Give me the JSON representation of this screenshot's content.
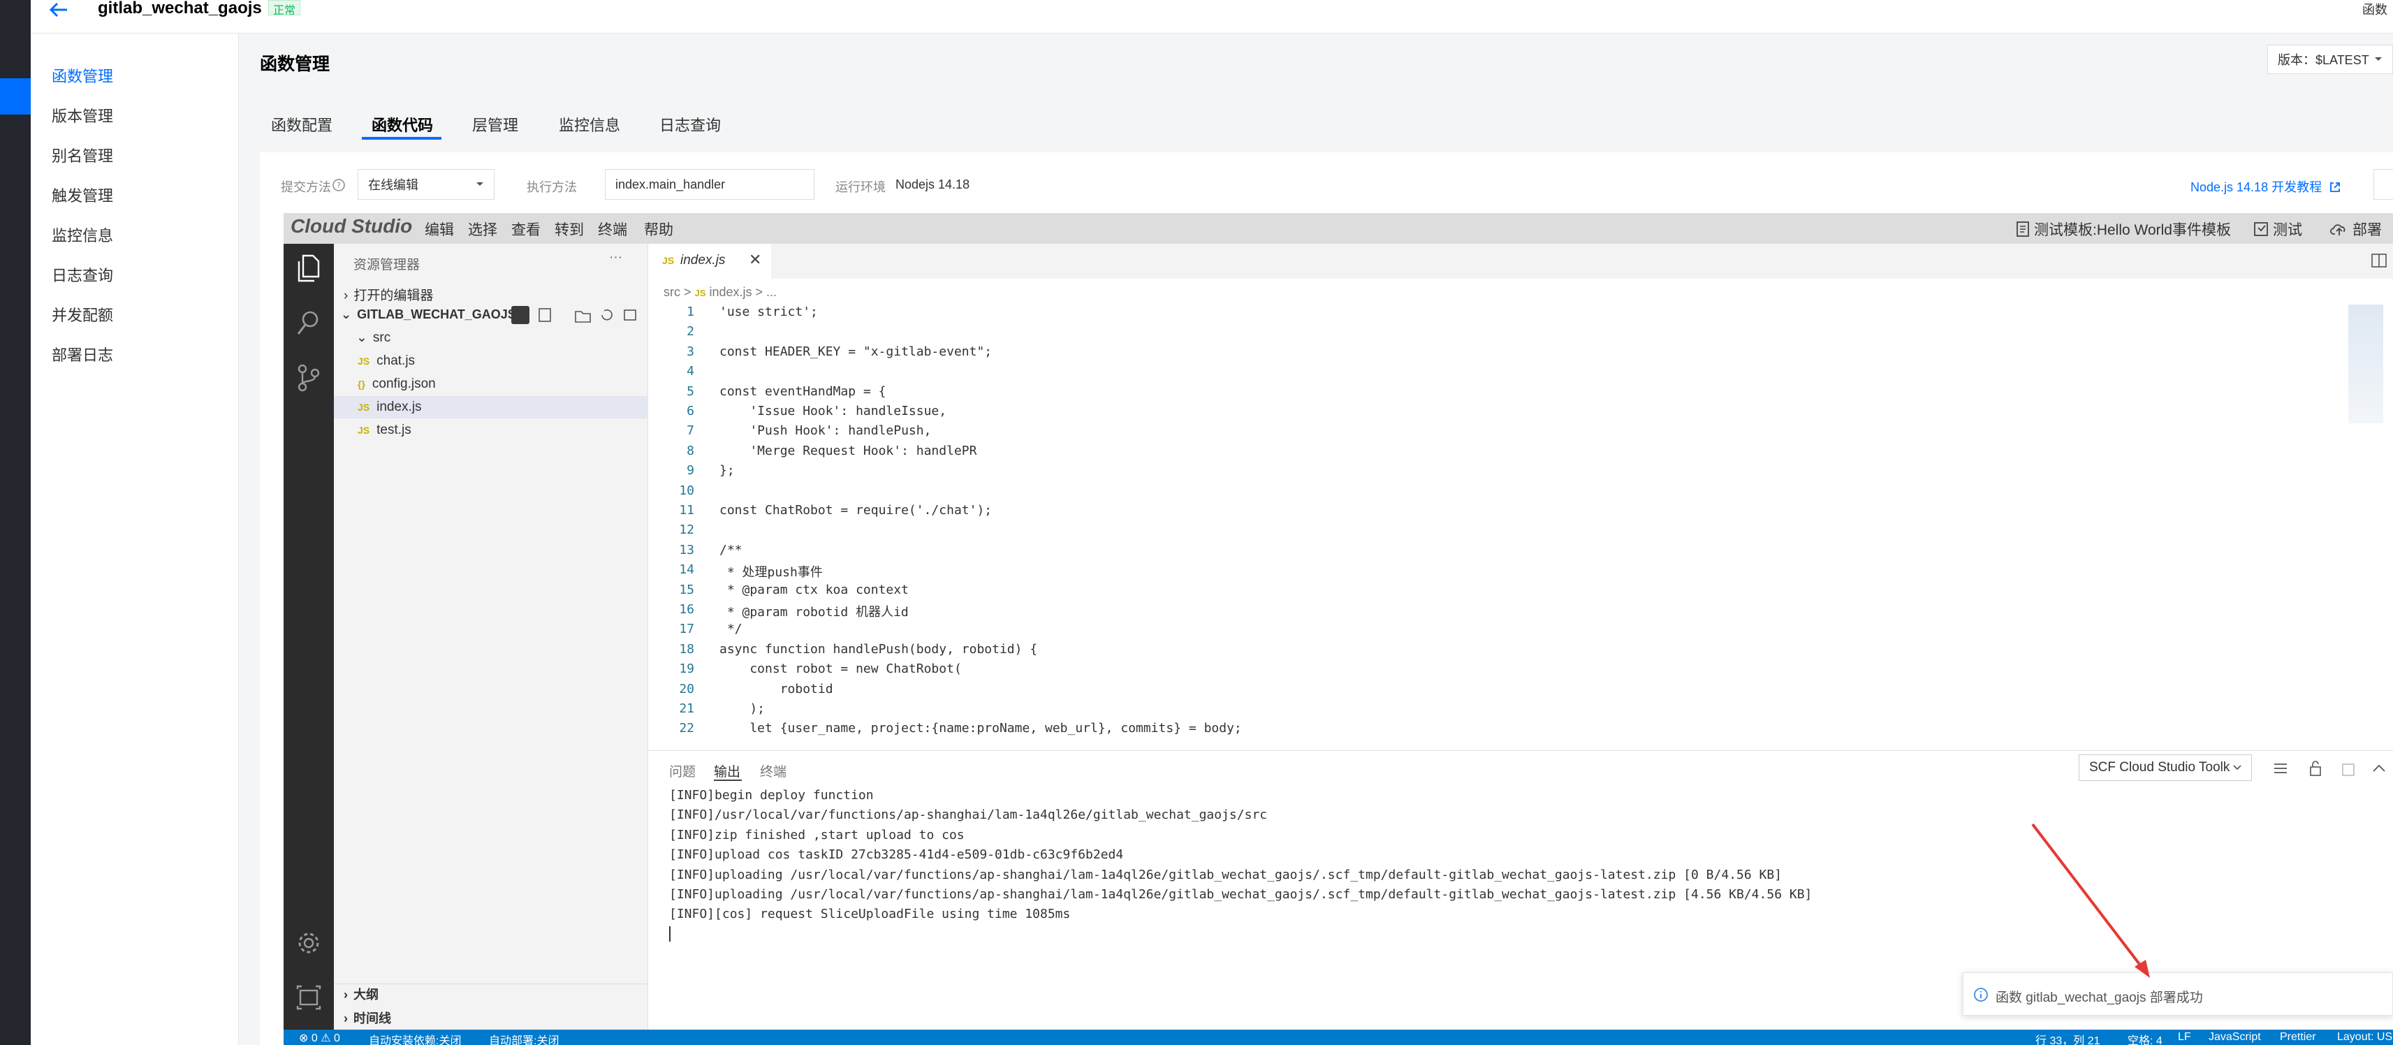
{
  "header": {
    "title": "gitlab_wechat_gaojs",
    "status_badge": "正常",
    "right_text": "函数"
  },
  "sidebar": {
    "items": [
      {
        "label": "函数管理",
        "active": true
      },
      {
        "label": "版本管理"
      },
      {
        "label": "别名管理"
      },
      {
        "label": "触发管理"
      },
      {
        "label": "监控信息"
      },
      {
        "label": "日志查询"
      },
      {
        "label": "并发配额"
      },
      {
        "label": "部署日志"
      }
    ]
  },
  "page": {
    "title": "函数管理",
    "version_label": "版本：$LATEST"
  },
  "tabs": [
    {
      "label": "函数配置"
    },
    {
      "label": "函数代码",
      "active": true
    },
    {
      "label": "层管理"
    },
    {
      "label": "监控信息"
    },
    {
      "label": "日志查询"
    }
  ],
  "form": {
    "submit_label": "提交方法",
    "submit_value": "在线编辑",
    "exec_label": "执行方法",
    "exec_value": "index.main_handler",
    "runtime_label": "运行环境",
    "runtime_value": "Nodejs 14.18",
    "doc_link": "Node.js 14.18 开发教程"
  },
  "ide": {
    "brand": "Cloud Studio",
    "menu": [
      "编辑",
      "选择",
      "查看",
      "转到",
      "终端",
      "帮助"
    ],
    "test_template": "测试模板:Hello World事件模板",
    "test_btn": "测试",
    "deploy_btn": "部署",
    "explorer": {
      "title": "资源管理器",
      "open_editors": "打开的编辑器",
      "project": "GITLAB_WECHAT_GAOJS",
      "folder": "src",
      "files": [
        "chat.js",
        "config.json",
        "index.js",
        "test.js"
      ],
      "outline": "大纲",
      "timeline": "时间线"
    },
    "editor": {
      "tab": "index.js",
      "breadcrumb": [
        "src",
        ">",
        "index.js",
        ">",
        "..."
      ],
      "lines": [
        "'use strict';",
        "",
        "const HEADER_KEY = \"x-gitlab-event\";",
        "",
        "const eventHandMap = {",
        "    'Issue Hook': handleIssue,",
        "    'Push Hook': handlePush,",
        "    'Merge Request Hook': handlePR",
        "};",
        "",
        "const ChatRobot = require('./chat');",
        "",
        "/**",
        " * 处理push事件",
        " * @param ctx koa context",
        " * @param robotid 机器人id",
        " */",
        "async function handlePush(body, robotid) {",
        "    const robot = new ChatRobot(",
        "        robotid",
        "    );",
        "    let {user_name, project:{name:proName, web_url}, commits} = body;"
      ]
    },
    "panel": {
      "tabs": [
        "问题",
        "输出",
        "终端"
      ],
      "output_channel": "SCF Cloud Studio Toolk",
      "lines": [
        "[INFO]begin deploy function",
        "[INFO]/usr/local/var/functions/ap-shanghai/lam-1a4ql26e/gitlab_wechat_gaojs/src",
        "[INFO]zip finished ,start upload to cos",
        "[INFO]upload cos taskID 27cb3285-41d4-e509-01db-c63c9f6b2ed4",
        "[INFO]uploading /usr/local/var/functions/ap-shanghai/lam-1a4ql26e/gitlab_wechat_gaojs/.scf_tmp/default-gitlab_wechat_gaojs-latest.zip [0 B/4.56 KB]",
        "[INFO]uploading /usr/local/var/functions/ap-shanghai/lam-1a4ql26e/gitlab_wechat_gaojs/.scf_tmp/default-gitlab_wechat_gaojs-latest.zip [4.56 KB/4.56 KB]",
        "[INFO][cos] request SliceUploadFile using time 1085ms"
      ]
    },
    "status": {
      "errors": "⊗ 0 ⚠ 0",
      "auto_install": "自动安装依赖:关闭",
      "auto_deploy": "自动部署:关闭",
      "position": "行 33，列 21",
      "spaces": "空格: 4",
      "eol": "LF",
      "language": "JavaScript",
      "prettier": "Prettier",
      "layout": "Layout: US"
    }
  },
  "toast": {
    "message": "函数 gitlab_wechat_gaojs 部署成功"
  },
  "colors": {
    "primary": "#006eff",
    "status_bar": "#007acc",
    "success": "#0abf5b",
    "annotation": "#e53935"
  }
}
